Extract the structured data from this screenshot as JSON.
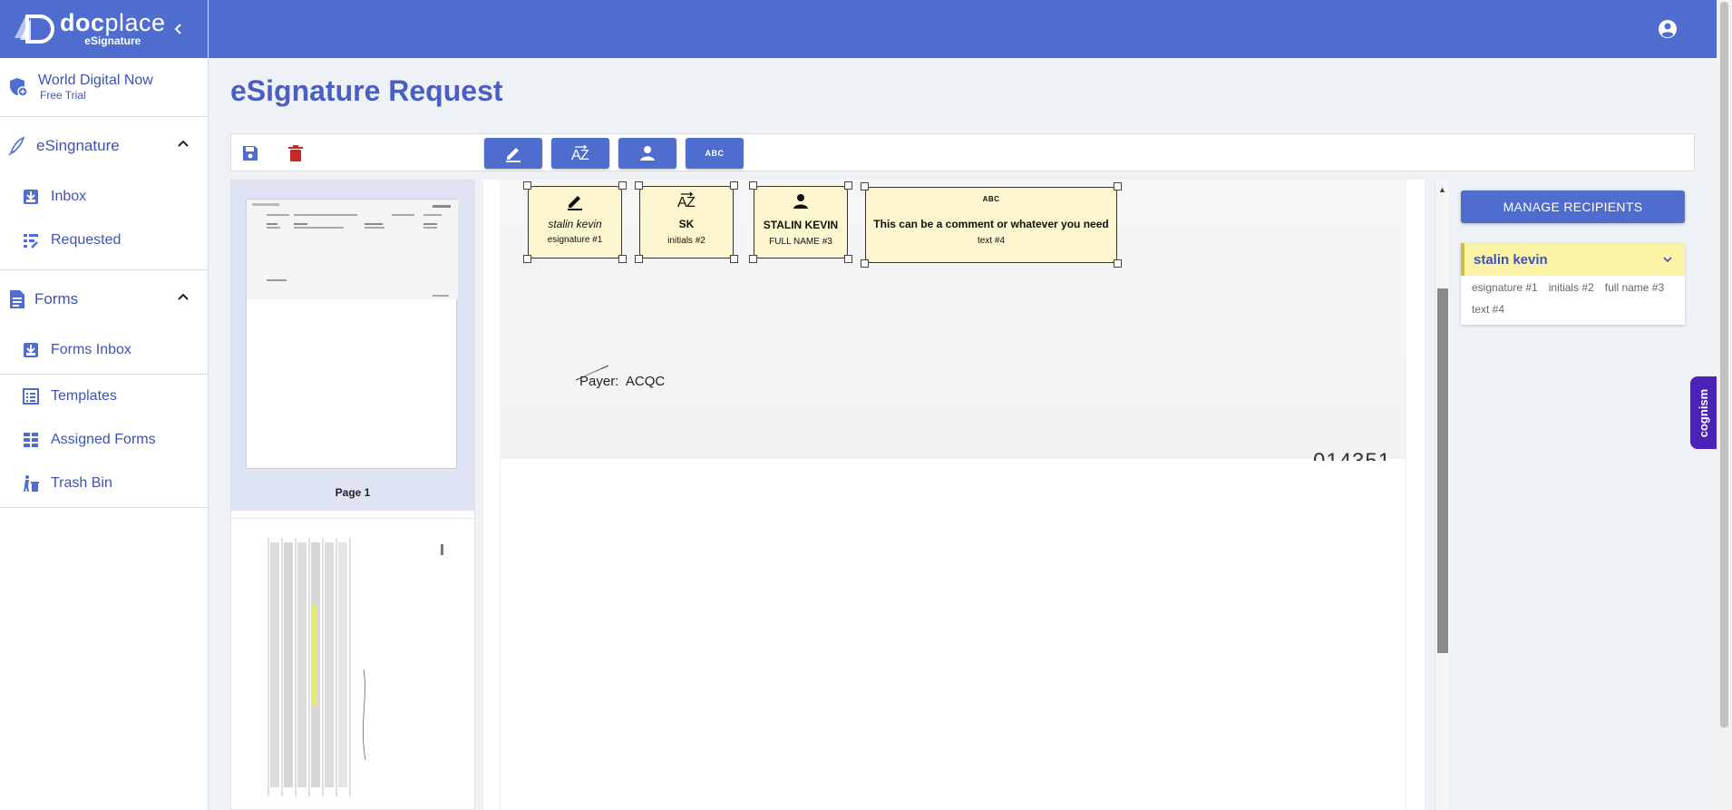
{
  "app": {
    "logo_word_bold": "doc",
    "logo_word_light": "place",
    "logo_sub": "eSignature"
  },
  "org": {
    "name": "World Digital Now",
    "plan": "Free Trial"
  },
  "sidebar": {
    "sections": [
      {
        "label": "eSingnature",
        "items": [
          {
            "label": "Inbox"
          },
          {
            "label": "Requested"
          }
        ]
      },
      {
        "label": "Forms",
        "items": [
          {
            "label": "Forms Inbox"
          },
          {
            "label": "Templates"
          },
          {
            "label": "Assigned Forms"
          },
          {
            "label": "Trash Bin"
          }
        ]
      }
    ]
  },
  "page": {
    "title": "eSignature Request"
  },
  "toolbar": {
    "abc_label": "ABC"
  },
  "thumbnails": [
    {
      "label": "Page 1"
    }
  ],
  "document": {
    "payer_label": "Payer:",
    "payer_value": "ACQC",
    "doc_number": "014351",
    "fields": [
      {
        "value": "stalin kevin",
        "tag": "esignature #1"
      },
      {
        "value": "SK",
        "tag": "initials #2"
      },
      {
        "value": "STALIN KEVIN",
        "tag": "FULL NAME #3"
      },
      {
        "value": "This can be a comment or whatever you need",
        "tag": "text #4",
        "icon_text": "ABC"
      }
    ]
  },
  "recipients": {
    "manage_label": "MANAGE RECIPIENTS",
    "list": [
      {
        "name": "stalin kevin",
        "fields": [
          "esignature #1",
          "initials #2",
          "full name #3",
          "text #4"
        ]
      }
    ]
  },
  "widget": {
    "label": "cognism"
  },
  "colors": {
    "brand": "#4f6ccf",
    "title": "#4a5fc1",
    "field_bg": "#fdf6cf",
    "delete": "#c62828"
  }
}
